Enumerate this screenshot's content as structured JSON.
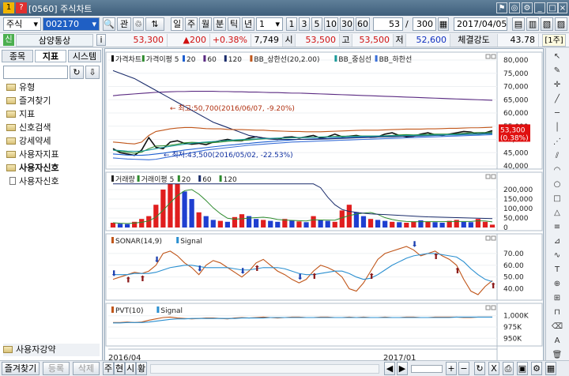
{
  "window": {
    "title": "[0560] 주식차트",
    "icon_label": "1",
    "help_label": "?"
  },
  "toolbar": {
    "market": "주식",
    "code": "002170",
    "chk_label": "관",
    "period_buttons": [
      "일",
      "주",
      "월",
      "분",
      "틱",
      "년"
    ],
    "sub_num": "1",
    "interval_buttons": [
      "1",
      "3",
      "5",
      "10",
      "30",
      "60"
    ],
    "count": "53",
    "total": "300",
    "date": "2017/04/05"
  },
  "quote": {
    "tag": "신",
    "name": "삼양통상",
    "info_label": "i",
    "price": "53,300",
    "change": "▲200",
    "change_pct": "+0.38%",
    "volume": "7,749",
    "open_label": "시",
    "open": "53,500",
    "high_label": "고",
    "high": "53,500",
    "low_label": "저",
    "low": "52,600",
    "strength_label": "체결강도",
    "strength": "43.78",
    "unit": "[1주]"
  },
  "left_panel": {
    "tabs": [
      "종목",
      "지표",
      "시스템"
    ],
    "active_tab": 1,
    "folders": [
      "유형",
      "즐겨찾기",
      "지표",
      "신호검색",
      "강세약세",
      "사용자지표",
      "사용자신호"
    ],
    "sub_item": "사용자신호",
    "bottom_folder": "사용자강약"
  },
  "bottom": {
    "buttons": [
      "즐겨찾기",
      "등록",
      "삭제"
    ],
    "tabs": [
      "주",
      "현",
      "시",
      "황"
    ]
  },
  "chart_data": [
    {
      "type": "line",
      "title": "가격차트",
      "legend": [
        "가격차트",
        "가격이평 5",
        "20",
        "60",
        "120",
        "BB_상한선(20,2.00)",
        "BB_중심선",
        "BB_하한선"
      ],
      "annotations": [
        "최고:50,700(2016/06/07, -9.20%)",
        "최저:43,500(2016/05/02, -22.53%)"
      ],
      "y_ticks": [
        "80,000",
        "75,000",
        "70,000",
        "65,000",
        "60,000",
        "55,000",
        "50,000",
        "45,000",
        "40,000"
      ],
      "ylim": [
        40000,
        80000
      ],
      "last": "53,300",
      "last_pct": "(0.38%)",
      "series": [
        {
          "name": "가격차트",
          "color": "#111111",
          "values": [
            46500,
            45000,
            44500,
            44000,
            46000,
            50700,
            47000,
            46500,
            49000,
            49500,
            48500,
            48200,
            48500,
            48000,
            49000,
            49500,
            50000,
            49500,
            49500,
            50500,
            51000,
            50500,
            50200,
            50000,
            50800,
            51000,
            50500,
            51000,
            51500,
            50500,
            51000,
            52000,
            51000,
            51200,
            51500,
            51000,
            50800,
            51000,
            52000,
            52500,
            51500,
            51000,
            51200,
            52000,
            52500,
            51800,
            51500,
            52000,
            52500,
            53000,
            52800,
            52000,
            52500,
            53300
          ]
        },
        {
          "name": "가격이평 5",
          "color": "#2e8b2e",
          "values": [
            46000,
            45500,
            45200,
            44800,
            45200,
            46500,
            47500,
            47600,
            47800,
            48200,
            48700,
            48900,
            48800,
            48700,
            48800,
            49000,
            49300,
            49500,
            49600,
            49800,
            50000,
            50200,
            50300,
            50400,
            50500,
            50600,
            50700,
            50700,
            50800,
            50900,
            51000,
            51100,
            51200,
            51200,
            51300,
            51300,
            51300,
            51300,
            51400,
            51500,
            51700,
            51800,
            51700,
            51800,
            51900,
            52000,
            52000,
            52000,
            52100,
            52300,
            52500,
            52600,
            52600,
            52800
          ]
        },
        {
          "name": "20",
          "color": "#1e5fd0",
          "values": [
            44500,
            44300,
            44100,
            44000,
            44000,
            44200,
            44500,
            44800,
            45200,
            45600,
            46000,
            46300,
            46600,
            46900,
            47200,
            47500,
            47800,
            48000,
            48300,
            48500,
            48800,
            49000,
            49200,
            49400,
            49600,
            49800,
            50000,
            50100,
            50200,
            50300,
            50400,
            50500,
            50600,
            50700,
            50800,
            50900,
            51000,
            51000,
            51000,
            51100,
            51200,
            51300,
            51300,
            51300,
            51400,
            51500,
            51600,
            51700,
            51700,
            51800,
            51900,
            52000,
            52100,
            52200
          ]
        },
        {
          "name": "60",
          "color": "#5a2a82",
          "values": [
            66500,
            66800,
            67000,
            67200,
            67400,
            67600,
            67800,
            67900,
            68000,
            68100,
            68100,
            68200,
            68200,
            68200,
            68200,
            68100,
            68100,
            68000,
            68000,
            67900,
            67900,
            67800,
            67700,
            67700,
            67600,
            67500,
            67500,
            67400,
            67300,
            67200,
            67100,
            67000,
            66900,
            66800,
            66700,
            66600,
            66500,
            66400,
            66300,
            66200,
            66100,
            66000,
            65900,
            65800,
            65700,
            65600,
            65500,
            65400,
            65300,
            65200,
            65100,
            65000,
            64900,
            64800
          ]
        },
        {
          "name": "120",
          "color": "#1a2c6b",
          "values": [
            76000,
            75000,
            74000,
            73000,
            71500,
            70000,
            68500,
            67000,
            65500,
            64000,
            62500,
            61000,
            59500,
            58000,
            56500,
            55500,
            54500,
            53500,
            52500,
            51500,
            51000,
            50500,
            50200,
            50000,
            50000,
            50000,
            50000,
            50000,
            50000,
            50100,
            50200,
            50300,
            50400,
            50500,
            50600,
            50700,
            50800,
            50900,
            51000,
            51000,
            51100,
            51200,
            51300,
            51400,
            51500,
            51600,
            51700,
            51800,
            51900,
            52000,
            52100,
            52200,
            52300,
            52400
          ]
        },
        {
          "name": "BB_상한선(20,2.00)",
          "color": "#c0561a",
          "values": [
            49000,
            48800,
            48500,
            48300,
            49000,
            51500,
            53000,
            53500,
            54000,
            54300,
            54500,
            54500,
            54300,
            54100,
            54000,
            54000,
            53800,
            53700,
            53700,
            53600,
            53500,
            53500,
            53300,
            53200,
            53100,
            53000,
            53000,
            52900,
            52900,
            52900,
            53000,
            53100,
            53200,
            53300,
            53400,
            53500,
            53500,
            53500,
            53600,
            53700,
            53800,
            53900,
            53900,
            53900,
            54000,
            54000,
            54100,
            54200,
            54200,
            54300,
            54400,
            54400,
            54500,
            54600
          ]
        },
        {
          "name": "BB_중심선",
          "color": "#1a9a9a",
          "values": [
            46000,
            45800,
            45600,
            45500,
            45600,
            46000,
            46500,
            47000,
            47400,
            47800,
            48200,
            48500,
            48800,
            49000,
            49200,
            49400,
            49600,
            49800,
            50000,
            50100,
            50200,
            50300,
            50400,
            50500,
            50600,
            50700,
            50700,
            50800,
            50800,
            50900,
            50900,
            51000,
            51000,
            51100,
            51100,
            51200,
            51200,
            51300,
            51300,
            51400,
            51400,
            51500,
            51500,
            51600,
            51600,
            51700,
            51700,
            51800,
            51800,
            51900,
            52000,
            52000,
            52100,
            52200
          ]
        },
        {
          "name": "BB_하한선",
          "color": "#3a6fd8",
          "values": [
            43000,
            42800,
            42600,
            42500,
            42400,
            42300,
            42500,
            43000,
            43500,
            44000,
            44500,
            45000,
            45500,
            46000,
            46300,
            46600,
            46900,
            47200,
            47500,
            47800,
            48000,
            48200,
            48400,
            48600,
            48800,
            49000,
            49100,
            49200,
            49300,
            49400,
            49500,
            49600,
            49700,
            49800,
            49900,
            50000,
            50100,
            50200,
            50300,
            50400,
            50500,
            50600,
            50700,
            50800,
            50900,
            51000,
            51100,
            51200,
            51300,
            51400,
            51500,
            51600,
            51700,
            51800
          ]
        }
      ]
    },
    {
      "type": "bar",
      "title": "거래량",
      "legend": [
        "거래량",
        "거래이평 5",
        "20",
        "60",
        "120"
      ],
      "y_ticks": [
        "200,000",
        "150,000",
        "100,000",
        "50,000",
        "0"
      ],
      "ylim": [
        0,
        250000
      ],
      "values": [
        25000,
        20000,
        18000,
        30000,
        45000,
        60000,
        120000,
        200000,
        230000,
        230000,
        190000,
        150000,
        80000,
        60000,
        40000,
        35000,
        30000,
        55000,
        70000,
        60000,
        45000,
        40000,
        35000,
        30000,
        45000,
        38000,
        32000,
        28000,
        60000,
        40000,
        35000,
        30000,
        90000,
        120000,
        80000,
        60000,
        45000,
        40000,
        35000,
        30000,
        28000,
        25000,
        32000,
        38000,
        30000,
        28000,
        25000,
        35000,
        40000,
        30000,
        28000,
        45000,
        30000,
        15000
      ],
      "up": [
        1,
        0,
        0,
        1,
        1,
        1,
        1,
        1,
        1,
        1,
        0,
        0,
        1,
        0,
        0,
        1,
        0,
        1,
        1,
        0,
        0,
        1,
        0,
        0,
        1,
        0,
        1,
        0,
        1,
        0,
        0,
        1,
        1,
        1,
        0,
        0,
        1,
        0,
        0,
        1,
        0,
        1,
        1,
        0,
        1,
        0,
        0,
        1,
        1,
        0,
        0,
        1,
        1,
        1
      ],
      "series": [
        {
          "name": "거래이평 5",
          "color": "#2e8b2e"
        },
        {
          "name": "60",
          "color": "#1a2c6b",
          "values": [
            230000,
            230000,
            230000,
            230000,
            230000,
            230000,
            230000,
            230000,
            230000,
            230000,
            230000,
            230000,
            230000,
            230000,
            230000,
            230000,
            230000,
            230000,
            230000,
            230000,
            230000,
            230000,
            230000,
            230000,
            230000,
            230000,
            230000,
            230000,
            230000,
            210000,
            160000,
            120000,
            95000,
            85000,
            80000,
            75000,
            72000,
            70000,
            68000,
            66000,
            64000,
            62000,
            60000,
            58000,
            56000,
            55000,
            54000,
            53000,
            52000,
            51000,
            50000,
            49000,
            48000,
            47000
          ]
        }
      ]
    },
    {
      "type": "line",
      "title": "SONAR(14,9)",
      "legend": [
        "SONAR(14,9)",
        "Signal"
      ],
      "y_ticks": [
        "70.00",
        "60.00",
        "50.00",
        "40.00"
      ],
      "ylim": [
        33,
        80
      ],
      "series": [
        {
          "name": "SONAR(14,9)",
          "color": "#c0561a",
          "values": [
            48,
            50,
            52,
            54,
            53,
            55,
            60,
            70,
            72,
            68,
            62,
            58,
            52,
            60,
            64,
            62,
            58,
            54,
            50,
            55,
            62,
            65,
            60,
            55,
            52,
            48,
            45,
            48,
            55,
            60,
            58,
            55,
            50,
            40,
            38,
            45,
            55,
            65,
            70,
            72,
            74,
            76,
            73,
            68,
            70,
            72,
            68,
            65,
            60,
            48,
            38,
            35,
            42,
            47
          ]
        },
        {
          "name": "Signal",
          "color": "#2a8fd0",
          "values": [
            52,
            52,
            52,
            53,
            53,
            53,
            54,
            56,
            58,
            59,
            60,
            60,
            59,
            58,
            58,
            58,
            58,
            57,
            56,
            56,
            57,
            58,
            58,
            58,
            57,
            55,
            53,
            52,
            52,
            53,
            54,
            55,
            55,
            53,
            50,
            48,
            49,
            52,
            56,
            60,
            63,
            66,
            68,
            69,
            70,
            70,
            69,
            68,
            67,
            63,
            57,
            52,
            48,
            46
          ]
        }
      ],
      "arrows_up": [
        2,
        4,
        20,
        28,
        36,
        45,
        48,
        53
      ],
      "arrows_down": [
        0,
        6,
        12,
        18,
        26,
        42,
        56
      ]
    },
    {
      "type": "line",
      "title": "PVT(10)",
      "legend": [
        "PVT(10)",
        "Signal"
      ],
      "y_ticks": [
        "1,000K",
        "975K",
        "950K"
      ],
      "ylim": [
        940,
        1010
      ],
      "series": [
        {
          "name": "PVT(10)",
          "color": "#c0561a",
          "values": [
            985,
            985,
            986,
            985,
            986,
            990,
            993,
            996,
            997,
            995,
            994,
            993,
            994,
            995,
            995,
            994,
            993,
            995,
            996,
            995,
            996,
            997,
            996,
            995,
            996,
            997,
            997,
            996,
            996,
            997,
            997,
            996,
            996,
            997,
            996,
            997,
            996,
            996,
            997,
            996,
            996,
            997,
            997,
            996,
            996,
            997,
            997,
            997,
            997,
            996,
            996,
            997,
            997,
            997
          ]
        },
        {
          "name": "Signal",
          "color": "#2a8fd0",
          "values": [
            984,
            984,
            985,
            985,
            985,
            986,
            988,
            990,
            992,
            993,
            993,
            994,
            994,
            994,
            994,
            994,
            994,
            994,
            995,
            995,
            995,
            995,
            996,
            996,
            996,
            996,
            996,
            996,
            996,
            996,
            996,
            996,
            996,
            996,
            996,
            996,
            996,
            996,
            996,
            996,
            996,
            996,
            996,
            996,
            996,
            996,
            996,
            996,
            997,
            997,
            997,
            997,
            997,
            997
          ]
        }
      ]
    }
  ],
  "x_axis": {
    "labels": [
      "2016/04",
      "2017/01"
    ]
  }
}
